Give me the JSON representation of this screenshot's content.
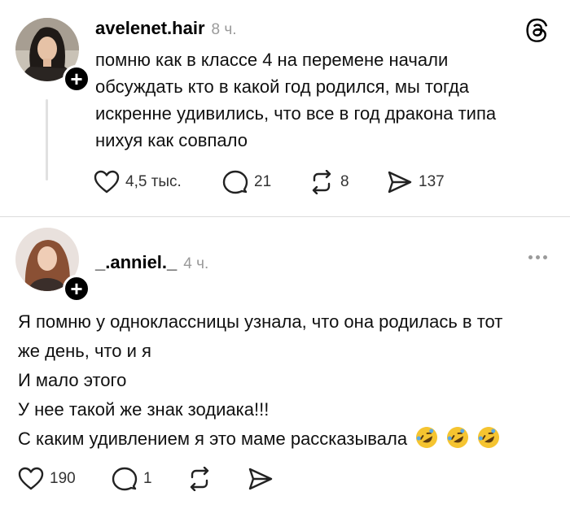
{
  "post1": {
    "username": "avelenet.hair",
    "time": "8 ч.",
    "lines": [
      "помню как в классе 4 на перемене начали",
      "обсуждать кто в какой год родился, мы тогда",
      "искренне удивились, что все в год дракона типа",
      "нихуя как совпало"
    ],
    "likes": "4,5 тыс.",
    "replies": "21",
    "reposts": "8",
    "shares": "137"
  },
  "post2": {
    "username": "_.anniel._",
    "time": "4 ч.",
    "lines": [
      "Я помню у одноклассницы узнала, что она родилась в тот",
      "же день, что и я",
      "И мало этого",
      "У нее такой же знак зодиака!!!",
      "С каким удивлением я это маме рассказывала"
    ],
    "emoji_count": 3,
    "likes": "190",
    "replies": "1"
  },
  "icons": {
    "follow": "plus-icon",
    "brand": "threads-logo-icon",
    "like": "heart-icon",
    "reply": "comment-icon",
    "repost": "repost-icon",
    "share": "send-icon",
    "more": "more-icon",
    "emoji": "rolling-on-floor-laughing-emoji"
  }
}
